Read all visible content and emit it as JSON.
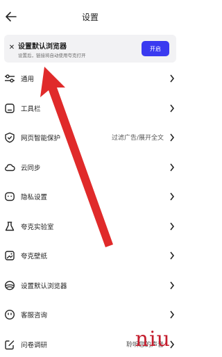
{
  "header": {
    "title": "设置",
    "back_icon": "back-arrow-icon"
  },
  "banner": {
    "close_icon": "close-icon",
    "title": "设置默认浏览器",
    "subtitle": "设置后，链接将自动使用夸克打开",
    "button_label": "开启",
    "accent": "#3a3af0"
  },
  "settings": {
    "items": [
      {
        "icon": "sliders-icon",
        "label": "通用",
        "value": ""
      },
      {
        "icon": "toolbar-icon",
        "label": "工具栏",
        "value": ""
      },
      {
        "icon": "shield-check-icon",
        "label": "网页智能保护",
        "value": "过滤广告/展开全文"
      },
      {
        "icon": "cloud-icon",
        "label": "云同步",
        "value": ""
      },
      {
        "icon": "privacy-mask-icon",
        "label": "隐私设置",
        "value": ""
      },
      {
        "icon": "flask-icon",
        "label": "夸克实验室",
        "value": ""
      },
      {
        "icon": "wallpaper-icon",
        "label": "夸克壁纸",
        "value": ""
      },
      {
        "icon": "browser-default-icon",
        "label": "设置默认浏览器",
        "value": ""
      },
      {
        "icon": "smiley-support-icon",
        "label": "客服咨询",
        "value": ""
      },
      {
        "icon": "survey-edit-icon",
        "label": "问卷调研",
        "value": "聆听您的声音"
      }
    ]
  },
  "annotation": {
    "color": "#e02a2a"
  },
  "watermark": {
    "text": "niu"
  }
}
